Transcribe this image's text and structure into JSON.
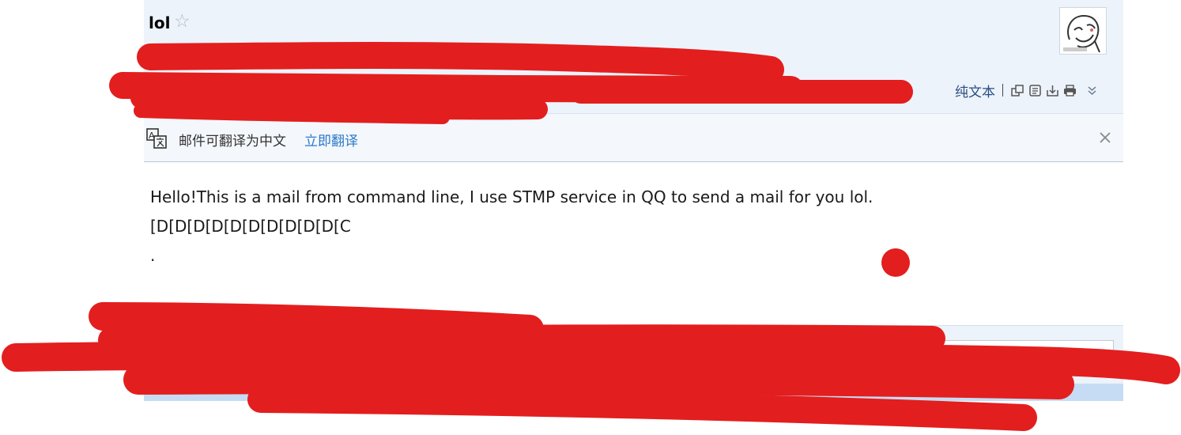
{
  "mail": {
    "subject": "lol",
    "star_icon": "star-outline-icon",
    "toolbar": {
      "plain_text_label": "纯文本",
      "icons": [
        "new-window-icon",
        "note-icon",
        "download-icon",
        "print-icon",
        "chevron-down-double-icon"
      ]
    },
    "translate_bar": {
      "icon": "translate-icon",
      "message": "邮件可翻译为中文",
      "action_label": "立即翻译",
      "close_icon": "close-icon"
    },
    "body_lines": [
      "Hello!This is a mail from command line, I use STMP service in QQ to send a mail for you lol.",
      "[D[D[D[D[D[D[D[D[D[D[C",
      "."
    ]
  },
  "colors": {
    "header_bg": "#edf3fb",
    "link_blue": "#2a79c9",
    "redaction_red": "#e31e1e"
  }
}
